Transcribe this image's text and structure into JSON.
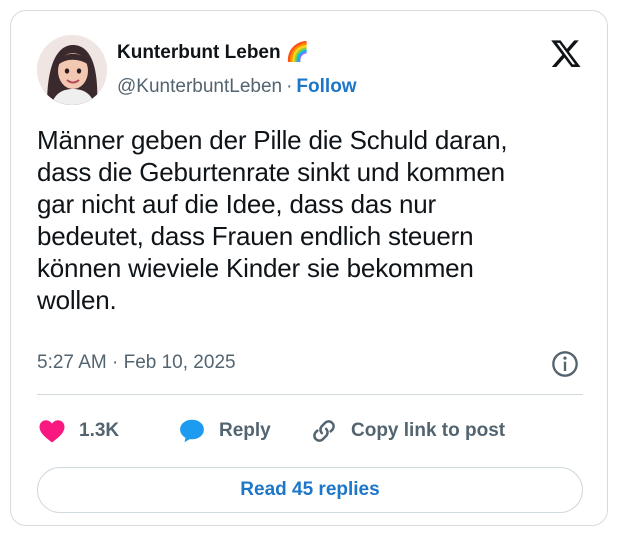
{
  "author": {
    "display_name": "Kunterbunt Leben 🌈",
    "handle": "@KunterbuntLeben",
    "separator": "·",
    "follow_label": "Follow"
  },
  "tweet": {
    "text": "Männer geben der Pille die Schuld daran,\ndass die Geburtenrate sinkt und kommen\ngar nicht auf die Idee, dass das nur\nbedeutet, dass Frauen endlich steuern\nkönnen wieviele Kinder sie bekommen\nwollen.",
    "timestamp": "5:27 AM · Feb 10, 2025"
  },
  "actions": {
    "like_count": "1.3K",
    "reply_label": "Reply",
    "copy_link_label": "Copy link to post"
  },
  "read_replies_label": "Read 45 replies",
  "icons": {
    "platform": "x-logo-icon",
    "info": "info-icon",
    "like": "heart-icon",
    "reply": "speech-bubble-icon",
    "copy": "link-icon"
  },
  "colors": {
    "text_primary": "#0f1419",
    "text_secondary": "#536471",
    "link": "#1d76c8",
    "heart": "#f91880",
    "reply_bubble": "#1d9bf0",
    "border": "#cfd9de"
  }
}
